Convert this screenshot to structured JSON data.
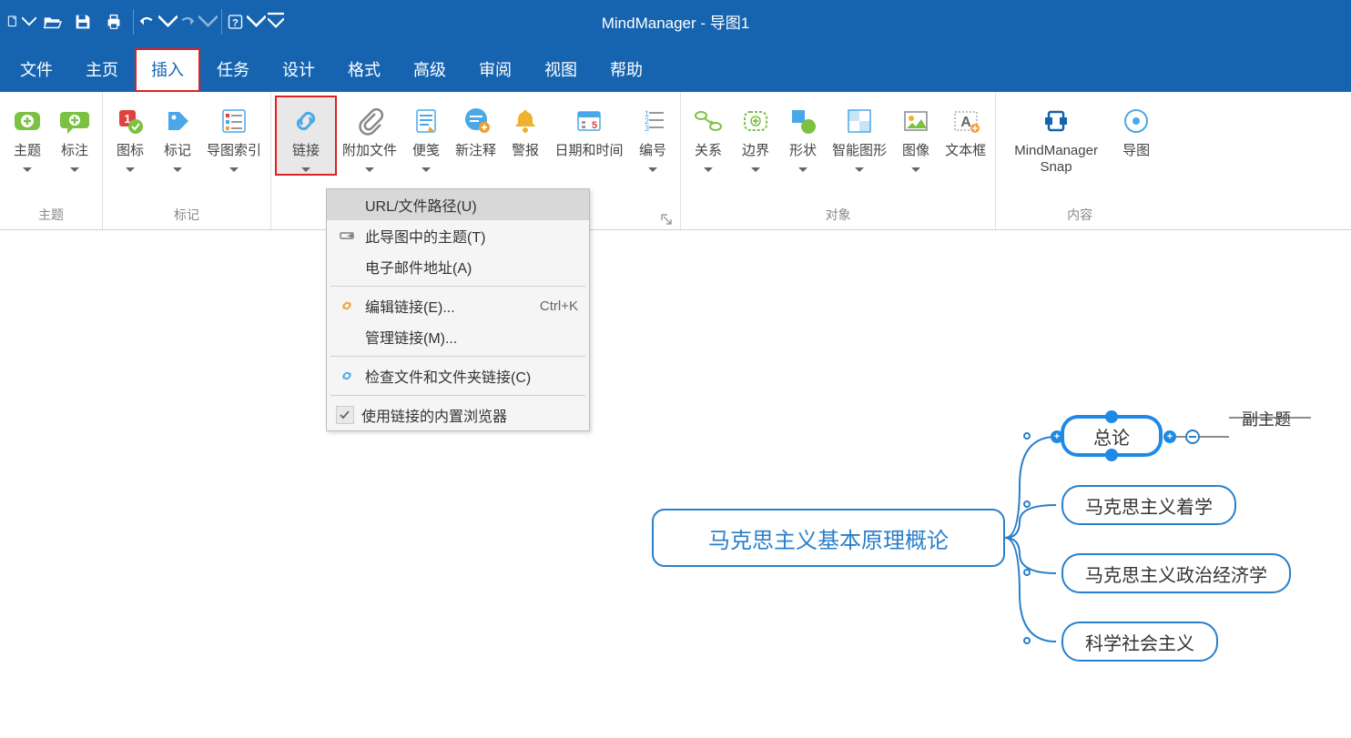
{
  "app_title": "MindManager - 导图1",
  "menus": [
    "文件",
    "主页",
    "插入",
    "任务",
    "设计",
    "格式",
    "高级",
    "审阅",
    "视图",
    "帮助"
  ],
  "selected_menu_index": 2,
  "ribbon_groups": [
    {
      "label": "主题",
      "buttons": [
        {
          "name": "topic",
          "label": "主题",
          "caret": true
        },
        {
          "name": "callout",
          "label": "标注",
          "caret": true
        }
      ]
    },
    {
      "label": "标记",
      "buttons": [
        {
          "name": "icon",
          "label": "图标",
          "caret": true
        },
        {
          "name": "tag",
          "label": "标记",
          "caret": true
        },
        {
          "name": "map-index",
          "label": "导图索引",
          "caret": true
        }
      ]
    },
    {
      "label": "",
      "buttons": [
        {
          "name": "link",
          "label": "链接",
          "caret": true,
          "highlighted": true
        },
        {
          "name": "attachment",
          "label": "附加文件",
          "caret": true
        },
        {
          "name": "note",
          "label": "便笺",
          "caret": true
        },
        {
          "name": "comment",
          "label": "新注释",
          "caret": false
        },
        {
          "name": "alert",
          "label": "警报",
          "caret": false
        },
        {
          "name": "datetime",
          "label": "日期和时间",
          "caret": false
        },
        {
          "name": "numbering",
          "label": "编号",
          "caret": true
        }
      ],
      "launcher": true
    },
    {
      "label": "对象",
      "buttons": [
        {
          "name": "relationship",
          "label": "关系",
          "caret": true
        },
        {
          "name": "boundary",
          "label": "边界",
          "caret": true
        },
        {
          "name": "shape",
          "label": "形状",
          "caret": true
        },
        {
          "name": "smart-shape",
          "label": "智能图形",
          "caret": true
        },
        {
          "name": "image",
          "label": "图像",
          "caret": true
        },
        {
          "name": "textbox",
          "label": "文本框",
          "caret": false
        }
      ]
    },
    {
      "label": "内容",
      "buttons": [
        {
          "name": "snap",
          "label": "MindManager\nSnap",
          "caret": false
        },
        {
          "name": "map-parts",
          "label": "导图",
          "caret": false
        }
      ]
    }
  ],
  "dropdown": {
    "items": [
      {
        "icon": "",
        "text": "URL/文件路径(U)",
        "hover": true
      },
      {
        "icon": "topic-in-map",
        "text": "此导图中的主题(T)"
      },
      {
        "icon": "",
        "text": "电子邮件地址(A)"
      },
      {
        "sep": true
      },
      {
        "icon": "link-edit",
        "text": "编辑链接(E)...",
        "shortcut": "Ctrl+K"
      },
      {
        "icon": "",
        "text": "管理链接(M)..."
      },
      {
        "sep": true
      },
      {
        "icon": "link-check",
        "text": "检查文件和文件夹链接(C)"
      },
      {
        "sep": true
      },
      {
        "icon": "check",
        "text": "使用链接的内置浏览器"
      }
    ]
  },
  "mind_map": {
    "central": "马克思主义基本原理概论",
    "branches": [
      {
        "text": "总论",
        "selected": true
      },
      {
        "text": "马克思主义着学"
      },
      {
        "text": "马克思主义政治经济学"
      },
      {
        "text": "科学社会主义"
      }
    ],
    "sub_label": "副主题"
  }
}
